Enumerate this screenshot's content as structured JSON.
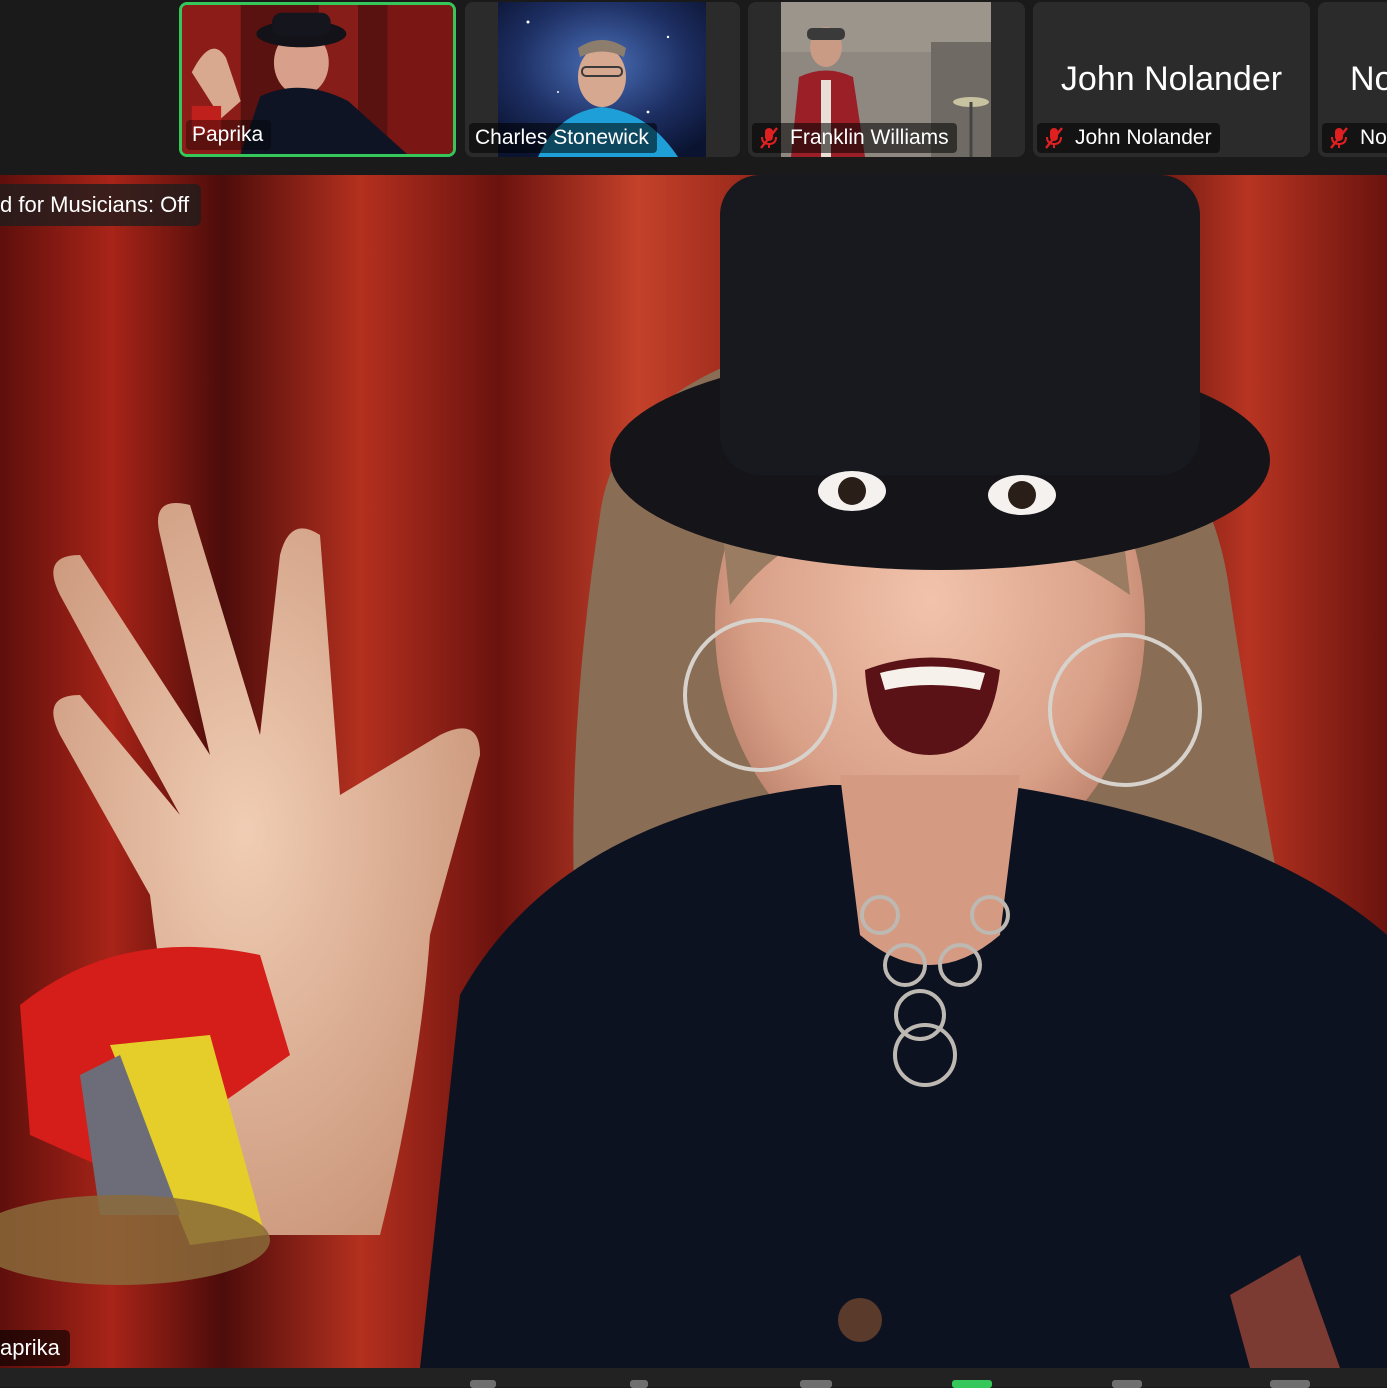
{
  "participants": [
    {
      "name": "Paprika",
      "muted": false,
      "active": true,
      "has_video": true
    },
    {
      "name": "Charles Stonewick",
      "muted": false,
      "active": false,
      "has_video": true
    },
    {
      "name": "Franklin Williams",
      "muted": true,
      "active": false,
      "has_video": true
    },
    {
      "name": "John Nolander",
      "display_name": "John Nolander",
      "muted": true,
      "active": false,
      "has_video": false
    },
    {
      "name": "Nor",
      "display_name": "No",
      "muted": true,
      "active": false,
      "has_video": false
    }
  ],
  "main": {
    "original_sound": "d for Musicians: Off",
    "speaker_name": "aprika"
  },
  "colors": {
    "active_border": "#35c759",
    "muted": "#e02020",
    "strip_bg": "#1a1a1a",
    "tile_bg": "#2b2b2b"
  }
}
